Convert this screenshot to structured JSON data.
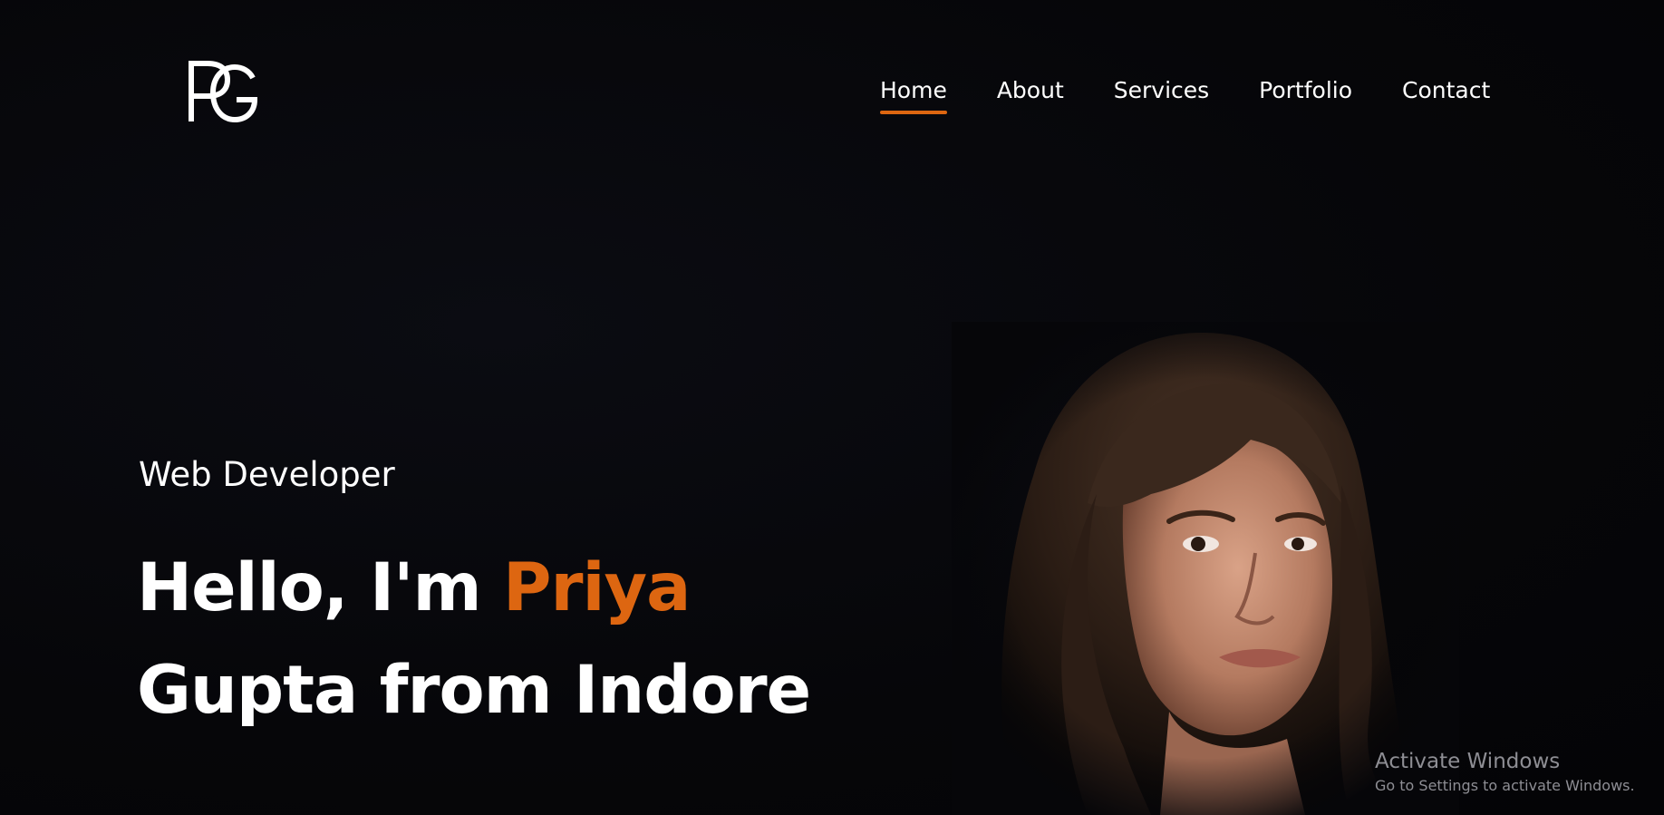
{
  "logo": {
    "text": "PG"
  },
  "nav": {
    "items": [
      {
        "label": "Home",
        "active": true
      },
      {
        "label": "About",
        "active": false
      },
      {
        "label": "Services",
        "active": false
      },
      {
        "label": "Portfolio",
        "active": false
      },
      {
        "label": "Contact",
        "active": false
      }
    ]
  },
  "hero": {
    "subtitle": "Web Developer",
    "greeting": "Hello, I'm ",
    "name_first": "Priya",
    "name_rest": "Gupta from Indore"
  },
  "watermark": {
    "title": "Activate Windows",
    "subtitle": "Go to Settings to activate Windows."
  },
  "colors": {
    "background": "#060609",
    "accent": "#dd6611",
    "text": "#ffffff"
  },
  "icons": [
    "pg-logo-icon"
  ]
}
